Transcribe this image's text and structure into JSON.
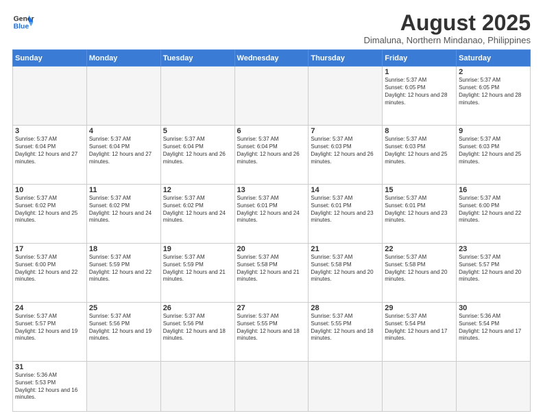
{
  "header": {
    "logo_line1": "General",
    "logo_line2": "Blue",
    "title": "August 2025",
    "subtitle": "Dimaluna, Northern Mindanao, Philippines"
  },
  "days_of_week": [
    "Sunday",
    "Monday",
    "Tuesday",
    "Wednesday",
    "Thursday",
    "Friday",
    "Saturday"
  ],
  "weeks": [
    [
      {
        "day": "",
        "empty": true
      },
      {
        "day": "",
        "empty": true
      },
      {
        "day": "",
        "empty": true
      },
      {
        "day": "",
        "empty": true
      },
      {
        "day": "",
        "empty": true
      },
      {
        "day": "1",
        "sunrise": "5:37 AM",
        "sunset": "6:05 PM",
        "daylight": "12 hours and 28 minutes."
      },
      {
        "day": "2",
        "sunrise": "5:37 AM",
        "sunset": "6:05 PM",
        "daylight": "12 hours and 28 minutes."
      }
    ],
    [
      {
        "day": "3",
        "sunrise": "5:37 AM",
        "sunset": "6:04 PM",
        "daylight": "12 hours and 27 minutes."
      },
      {
        "day": "4",
        "sunrise": "5:37 AM",
        "sunset": "6:04 PM",
        "daylight": "12 hours and 27 minutes."
      },
      {
        "day": "5",
        "sunrise": "5:37 AM",
        "sunset": "6:04 PM",
        "daylight": "12 hours and 26 minutes."
      },
      {
        "day": "6",
        "sunrise": "5:37 AM",
        "sunset": "6:04 PM",
        "daylight": "12 hours and 26 minutes."
      },
      {
        "day": "7",
        "sunrise": "5:37 AM",
        "sunset": "6:03 PM",
        "daylight": "12 hours and 26 minutes."
      },
      {
        "day": "8",
        "sunrise": "5:37 AM",
        "sunset": "6:03 PM",
        "daylight": "12 hours and 25 minutes."
      },
      {
        "day": "9",
        "sunrise": "5:37 AM",
        "sunset": "6:03 PM",
        "daylight": "12 hours and 25 minutes."
      }
    ],
    [
      {
        "day": "10",
        "sunrise": "5:37 AM",
        "sunset": "6:02 PM",
        "daylight": "12 hours and 25 minutes."
      },
      {
        "day": "11",
        "sunrise": "5:37 AM",
        "sunset": "6:02 PM",
        "daylight": "12 hours and 24 minutes."
      },
      {
        "day": "12",
        "sunrise": "5:37 AM",
        "sunset": "6:02 PM",
        "daylight": "12 hours and 24 minutes."
      },
      {
        "day": "13",
        "sunrise": "5:37 AM",
        "sunset": "6:01 PM",
        "daylight": "12 hours and 24 minutes."
      },
      {
        "day": "14",
        "sunrise": "5:37 AM",
        "sunset": "6:01 PM",
        "daylight": "12 hours and 23 minutes."
      },
      {
        "day": "15",
        "sunrise": "5:37 AM",
        "sunset": "6:01 PM",
        "daylight": "12 hours and 23 minutes."
      },
      {
        "day": "16",
        "sunrise": "5:37 AM",
        "sunset": "6:00 PM",
        "daylight": "12 hours and 22 minutes."
      }
    ],
    [
      {
        "day": "17",
        "sunrise": "5:37 AM",
        "sunset": "6:00 PM",
        "daylight": "12 hours and 22 minutes."
      },
      {
        "day": "18",
        "sunrise": "5:37 AM",
        "sunset": "5:59 PM",
        "daylight": "12 hours and 22 minutes."
      },
      {
        "day": "19",
        "sunrise": "5:37 AM",
        "sunset": "5:59 PM",
        "daylight": "12 hours and 21 minutes."
      },
      {
        "day": "20",
        "sunrise": "5:37 AM",
        "sunset": "5:58 PM",
        "daylight": "12 hours and 21 minutes."
      },
      {
        "day": "21",
        "sunrise": "5:37 AM",
        "sunset": "5:58 PM",
        "daylight": "12 hours and 20 minutes."
      },
      {
        "day": "22",
        "sunrise": "5:37 AM",
        "sunset": "5:58 PM",
        "daylight": "12 hours and 20 minutes."
      },
      {
        "day": "23",
        "sunrise": "5:37 AM",
        "sunset": "5:57 PM",
        "daylight": "12 hours and 20 minutes."
      }
    ],
    [
      {
        "day": "24",
        "sunrise": "5:37 AM",
        "sunset": "5:57 PM",
        "daylight": "12 hours and 19 minutes."
      },
      {
        "day": "25",
        "sunrise": "5:37 AM",
        "sunset": "5:56 PM",
        "daylight": "12 hours and 19 minutes."
      },
      {
        "day": "26",
        "sunrise": "5:37 AM",
        "sunset": "5:56 PM",
        "daylight": "12 hours and 18 minutes."
      },
      {
        "day": "27",
        "sunrise": "5:37 AM",
        "sunset": "5:55 PM",
        "daylight": "12 hours and 18 minutes."
      },
      {
        "day": "28",
        "sunrise": "5:37 AM",
        "sunset": "5:55 PM",
        "daylight": "12 hours and 18 minutes."
      },
      {
        "day": "29",
        "sunrise": "5:37 AM",
        "sunset": "5:54 PM",
        "daylight": "12 hours and 17 minutes."
      },
      {
        "day": "30",
        "sunrise": "5:36 AM",
        "sunset": "5:54 PM",
        "daylight": "12 hours and 17 minutes."
      }
    ],
    [
      {
        "day": "31",
        "sunrise": "5:36 AM",
        "sunset": "5:53 PM",
        "daylight": "12 hours and 16 minutes."
      },
      {
        "day": "",
        "empty": true
      },
      {
        "day": "",
        "empty": true
      },
      {
        "day": "",
        "empty": true
      },
      {
        "day": "",
        "empty": true
      },
      {
        "day": "",
        "empty": true
      },
      {
        "day": "",
        "empty": true
      }
    ]
  ]
}
